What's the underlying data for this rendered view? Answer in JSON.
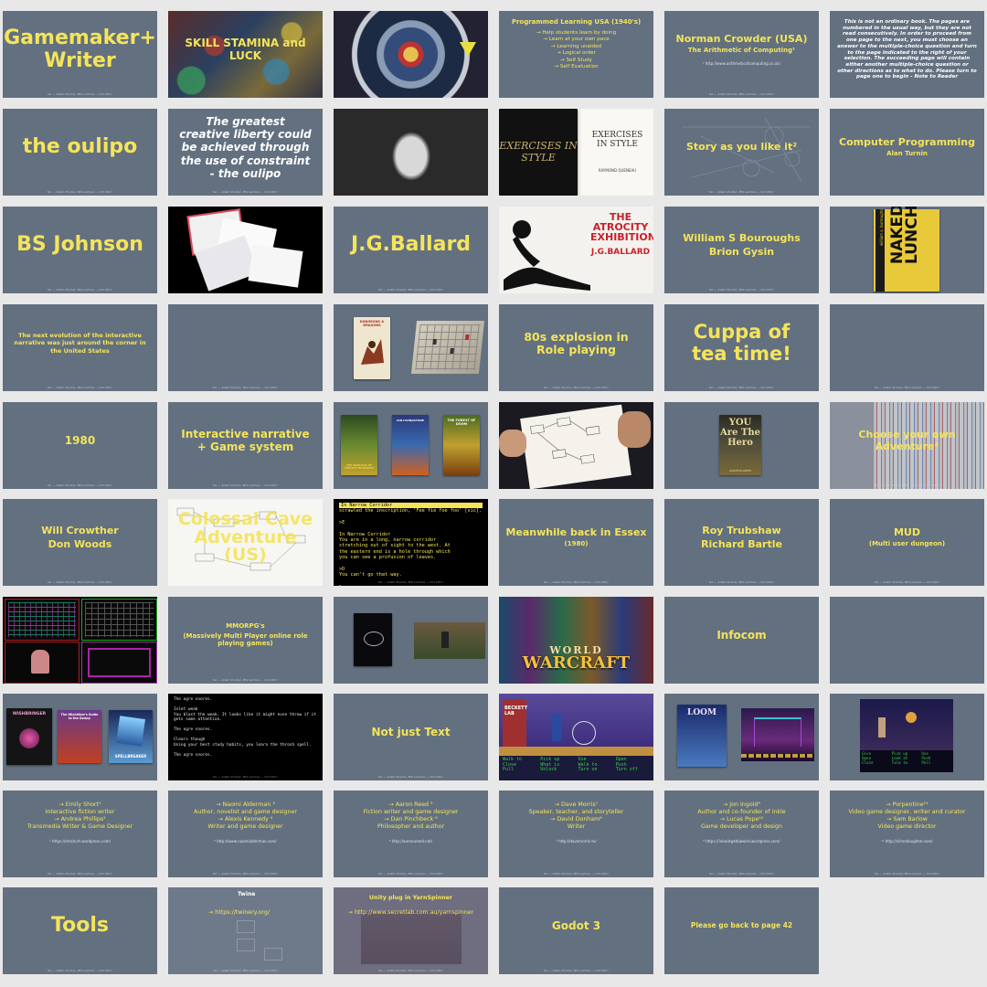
{
  "colors": {
    "slate": "#637080",
    "yellow": "#f4e45a",
    "background": "#e8e8e8"
  },
  "slides": {
    "r1c1": {
      "line1": "Gamemaker+",
      "line2": "Writer"
    },
    "r1c2": {
      "title": "SKILL STAMINA and LUCK"
    },
    "r1c4": {
      "title": "Programmed Learning USA (1940's)",
      "bullets": [
        "Help students learn by doing",
        "Learn at your own pace",
        "Learning unaided",
        "Logical order",
        "Self Study",
        "Self Evaluation"
      ]
    },
    "r1c5": {
      "title": "Norman Crowder (USA)",
      "subtitle": "The Arithmetic of Computing¹",
      "url": "¹ http://www.arithmeticofcomputing.co.uk/"
    },
    "r1c6": {
      "text": "This is not an ordinary book. The pages are numbered in the usual way, but they are not read consecutively. In order to proceed from one page to the next, you must choose an answer to the multiple-choice question and turn to the page indicated to the right of your selection. The succeeding page will contain either another multiple-choice question or other directions as to what to do. Please turn to page one to begin - Note to Reader"
    },
    "r2c1": {
      "title": "the oulipo"
    },
    "r2c2": {
      "text": "The greatest creative liberty could be achieved through the use of constraint - the oulipo"
    },
    "r2c4": {
      "left_title": "EXERCISES IN STYLE",
      "right_title": "EXERCISES IN STYLE",
      "author": "RAYMOND QUENEAU"
    },
    "r2c5": {
      "title": "Story as you like it²"
    },
    "r2c6": {
      "title": "Computer Programming",
      "subtitle": "Alan Turnin"
    },
    "r3c1": {
      "title": "BS Johnson"
    },
    "r3c3": {
      "title": "J.G.Ballard"
    },
    "r3c4": {
      "book_title": "THE ATROCITY EXHIBITION",
      "author": "J.G.BALLARD"
    },
    "r3c5": {
      "line1": "William S Bouroughs",
      "line2": "Brion Gysin"
    },
    "r3c6": {
      "author": "william s. burroughs",
      "book_title": "NAKED LUNCH"
    },
    "r4c1": {
      "text": "The next evolution of the interactive narrative was just around the corner in the United States"
    },
    "r4c3": {
      "book_title": "DUNGEONS & DRAGONS"
    },
    "r4c4": {
      "title": "80s explosion in Role playing"
    },
    "r4c5": {
      "title": "Cuppa of tea time!"
    },
    "r5c1": {
      "title": "1980"
    },
    "r5c2": {
      "title": "Interactive narrative + Game system"
    },
    "r5c3": {
      "book1": "THE WARLOCK OF FIRETOP MOUNTAIN",
      "book2": "IAN LIVINGSTONE",
      "book3": "THE FOREST OF DOOM"
    },
    "r5c5": {
      "book_title": "YOU Are The Hero",
      "author": "JONATHAN GREEN"
    },
    "r5c6": {
      "title": "Choose your own Adventure⁴"
    },
    "r6c1": {
      "line1": "Will Crowther",
      "line2": "Don Woods"
    },
    "r6c2": {
      "title": "Colossal Cave Adventure (US)"
    },
    "r6c3": {
      "header": "In Narrow Corridor",
      "lines": [
        "scrawled the inscription, 'Fee fie foe foo' [sic].",
        "",
        ">E",
        "",
        "In Narrow Corridor",
        "You are in a long, narrow corridor",
        "stretching out of sight to the west. At",
        "the eastern end is a hole through which",
        "you can see a profusion of leaves.",
        "",
        ">D",
        "You can't go that way.",
        "",
        ">"
      ]
    },
    "r6c4": {
      "title": "Meanwhile back in Essex",
      "subtitle": "(1980)"
    },
    "r6c5": {
      "line1": "Roy Trubshaw",
      "line2": "Richard Bartle"
    },
    "r6c6": {
      "title": "MUD",
      "subtitle": "(Multi user dungeon)"
    },
    "r7c2": {
      "title": "MMORPG's",
      "subtitle": "(Massively Multi Player online role playing games)"
    },
    "r7c4": {
      "logo_line1": "WORLD",
      "logo_line2": "WARCRAFT"
    },
    "r7c5": {
      "title": "Infocom"
    },
    "r8c1": {
      "box1": "WISHBRINGER",
      "box2": "The Hitchhiker's Guide to the Galaxy",
      "box3": "SPELLBREAKER"
    },
    "r8c2": {
      "lines": [
        "The ogre snores.",
        "",
        "Inlet weak",
        "You blast the weak. It looks like it might even throw if it gets some attention.",
        "",
        "The ogre snores.",
        "",
        "Clears though",
        "Using your best study habits, you learn the throsh spell.",
        "",
        "The ogre snores."
      ]
    },
    "r8c3": {
      "title": "Not just Text"
    },
    "r8c4": {
      "sign": "BECKETT LAB",
      "verbs": [
        "Walk to",
        "Pick up",
        "Use",
        "Open",
        "Close",
        "What is",
        "Walk to",
        "Push",
        "Pull",
        "Unlock",
        "Turn on",
        "Turn off"
      ]
    },
    "r8c5": {
      "box_title": "LOOM"
    },
    "r8c6": {
      "verbs": [
        "Give",
        "Pick up",
        "Use",
        "Open",
        "Look at",
        "Push",
        "Close",
        "Talk to",
        "Pull"
      ]
    },
    "r9c1": {
      "people": [
        {
          "name": "Emily Short¹",
          "role": "Interactive fiction writer"
        },
        {
          "name": "Andrea Phillips²",
          "role": "Transmedia Writer & Game Designer"
        }
      ],
      "url": "¹ https://emshort.wordpress.com/"
    },
    "r9c2": {
      "people": [
        {
          "name": "Naomi Alderman ³",
          "role": "Author, novelist and game designer"
        },
        {
          "name": "Alexis Kennedy ⁴",
          "role": "Writer and game designer"
        }
      ],
      "url": "³ http://www.naomialderman.com/"
    },
    "r9c3": {
      "people": [
        {
          "name": "Aaron Reed ⁵",
          "role": "Fiction writer and game designer"
        },
        {
          "name": "Dan Pinchbeck ⁶",
          "role": "Philosopher and author"
        }
      ],
      "url": "⁵ http://aaronareed.net/"
    },
    "r9c4": {
      "people": [
        {
          "name": "Dave Morris⁷",
          "role": "Speaker, teacher, and storyteller"
        },
        {
          "name": "David Donham⁸",
          "role": "Writer"
        }
      ],
      "url": "⁷ http://davemorris.tv/"
    },
    "r9c5": {
      "people": [
        {
          "name": "Jon Ingold⁹",
          "role": "Author and co-founder of inkle"
        },
        {
          "name": "Lucas Pope¹⁰",
          "role": "Game developer and design"
        }
      ],
      "url": "⁹ https://inkwidgetbiweird.wordpress.com/"
    },
    "r9c6": {
      "people": [
        {
          "name": "Porpentine¹¹",
          "role": "Video game designer, writer and curator"
        },
        {
          "name": "Sam Barlow",
          "role": "Video game director"
        }
      ],
      "url": "¹¹ http://slimedaughter.com/"
    },
    "r10c1": {
      "title": "Tools"
    },
    "r10c2": {
      "app_name": "Twine",
      "url": "https://twinery.org/"
    },
    "r10c3": {
      "title": "Unity plug in YarnSpinner",
      "url": "http://www.secretlab.com.au/yarnspinner"
    },
    "r10c4": {
      "title": "Godot 3"
    },
    "r10c5": {
      "title": "Please go back to page 42"
    }
  },
  "footer_text": "SA — Adam Procter, BIS Lecture — Oct 2017"
}
